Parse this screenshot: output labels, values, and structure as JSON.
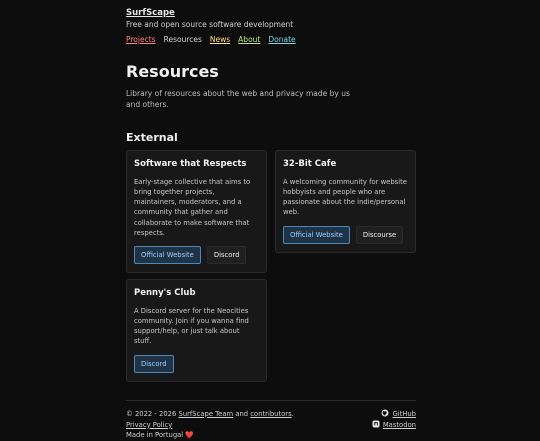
{
  "site": {
    "title": "SurfScape",
    "tagline": "Free and open source software development"
  },
  "nav": [
    {
      "label": "Projects",
      "color": "#ff8080"
    },
    {
      "label": "Resources",
      "color": "#d6d6d6"
    },
    {
      "label": "News",
      "color": "#ffe082"
    },
    {
      "label": "About",
      "color": "#b9e67a"
    },
    {
      "label": "Donate",
      "color": "#7ad6e6"
    }
  ],
  "page": {
    "title": "Resources",
    "description": "Library of resources about the web and privacy made by us and others."
  },
  "section": {
    "title": "External"
  },
  "cards": [
    {
      "title": "Software that Respects",
      "description": "Early-stage collective that aims to bring together projects, maintainers, moderators, and a community that gather and collaborate to make software that respects.",
      "buttons": [
        "Official Website",
        "Discord"
      ]
    },
    {
      "title": "32-Bit Cafe",
      "description": "A welcoming community for website hobbyists and people who are passionate about the indie/personal web.",
      "buttons": [
        "Official Website",
        "Discourse"
      ]
    },
    {
      "title": "Penny's Club",
      "description": "A Discord server for the Neocities community. Join if you wanna find support/help, or just talk about stuff.",
      "buttons": [
        "Discord"
      ]
    }
  ],
  "footer": {
    "copyright_prefix": "© 2022 - 2026",
    "team_link": "SurfScape Team",
    "and": "and",
    "contributors_link": "contributors",
    "period": ".",
    "privacy": "Privacy Policy",
    "made_in": "Made in Portugal",
    "heart": "❤️",
    "github": "GitHub",
    "mastodon": "Mastodon"
  }
}
